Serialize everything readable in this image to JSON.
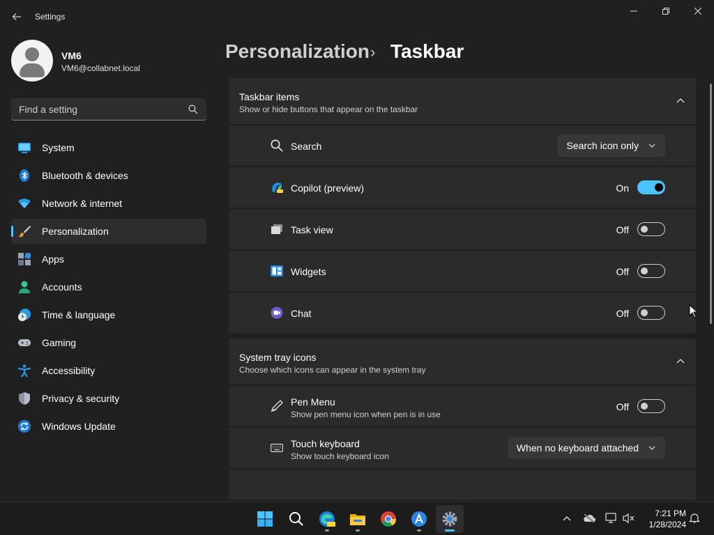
{
  "window": {
    "app_title": "Settings",
    "back_icon": "back-arrow-icon",
    "controls": [
      "minimize-icon",
      "maximize-icon",
      "close-icon"
    ]
  },
  "profile": {
    "name": "VM6",
    "email": "VM6@collabnet.local"
  },
  "search": {
    "placeholder": "Find a setting",
    "value": ""
  },
  "sidebar": {
    "items": [
      {
        "label": "System",
        "icon": "system-display-icon",
        "active": false
      },
      {
        "label": "Bluetooth & devices",
        "icon": "bluetooth-icon",
        "active": false
      },
      {
        "label": "Network & internet",
        "icon": "wifi-icon",
        "active": false
      },
      {
        "label": "Personalization",
        "icon": "paintbrush-icon",
        "active": true
      },
      {
        "label": "Apps",
        "icon": "apps-icon",
        "active": false
      },
      {
        "label": "Accounts",
        "icon": "person-icon",
        "active": false
      },
      {
        "label": "Time & language",
        "icon": "globe-clock-icon",
        "active": false
      },
      {
        "label": "Gaming",
        "icon": "gamepad-icon",
        "active": false
      },
      {
        "label": "Accessibility",
        "icon": "accessibility-icon",
        "active": false
      },
      {
        "label": "Privacy & security",
        "icon": "shield-icon",
        "active": false
      },
      {
        "label": "Windows Update",
        "icon": "update-icon",
        "active": false
      }
    ]
  },
  "breadcrumb": {
    "parent": "Personalization",
    "separator": "›",
    "current": "Taskbar"
  },
  "taskbar_items": {
    "title": "Taskbar items",
    "subtitle": "Show or hide buttons that appear on the taskbar",
    "rows": [
      {
        "label": "Search",
        "icon": "search-icon",
        "control": "dropdown",
        "value": "Search icon only"
      },
      {
        "label": "Copilot (preview)",
        "icon": "copilot-icon",
        "control": "toggle",
        "state": "On",
        "on": true
      },
      {
        "label": "Task view",
        "icon": "task-view-icon",
        "control": "toggle",
        "state": "Off",
        "on": false
      },
      {
        "label": "Widgets",
        "icon": "widgets-icon",
        "control": "toggle",
        "state": "Off",
        "on": false
      },
      {
        "label": "Chat",
        "icon": "chat-icon",
        "control": "toggle",
        "state": "Off",
        "on": false
      }
    ]
  },
  "system_tray": {
    "title": "System tray icons",
    "subtitle": "Choose which icons can appear in the system tray",
    "rows": [
      {
        "label": "Pen Menu",
        "sub": "Show pen menu icon when pen is in use",
        "icon": "pen-icon",
        "control": "toggle",
        "state": "Off",
        "on": false
      },
      {
        "label": "Touch keyboard",
        "sub": "Show touch keyboard icon",
        "icon": "keyboard-icon",
        "control": "dropdown",
        "value": "When no keyboard attached"
      }
    ]
  },
  "taskbar": {
    "apps": [
      "windows-start-icon",
      "search-icon",
      "edge-preview-icon",
      "file-explorer-icon",
      "chrome-icon",
      "app-installer-icon",
      "settings-icon"
    ],
    "tray": [
      "chevron-up-icon",
      "onedrive-offline-icon",
      "network-icon",
      "volume-muted-icon"
    ],
    "time": "7:21 PM",
    "date": "1/28/2024",
    "notification_icon": "bell-icon"
  },
  "colors": {
    "accent": "#4cc2ff",
    "background": "#202020",
    "card": "#2b2b2b"
  }
}
